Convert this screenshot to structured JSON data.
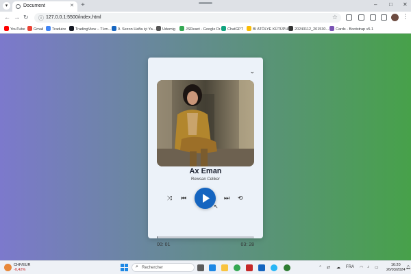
{
  "browser": {
    "tab_title": "Document",
    "tab_menu_icon": "chevron-down-icon",
    "tab_close": "✕",
    "new_tab": "+",
    "url": "127.0.0.1:5500/index.html",
    "window_controls": [
      "–",
      "□",
      "✕"
    ]
  },
  "bookmarks": [
    {
      "label": "YouTube",
      "color": "#ff0000"
    },
    {
      "label": "Gmail",
      "color": "#ea4335"
    },
    {
      "label": "Traduire",
      "color": "#4285f4"
    },
    {
      "label": "TradingView – Türn...",
      "color": "#131722"
    },
    {
      "label": "9. Sezon Hafta içi Ya...",
      "color": "#1565c0"
    },
    {
      "label": "Udemig",
      "color": "#555555"
    },
    {
      "label": "JSReact - Google Dr...",
      "color": "#34a853"
    },
    {
      "label": "ChatGPT",
      "color": "#10a37f"
    },
    {
      "label": "BI ATÖLYE KÜTÜPH...",
      "color": "#fbbc04"
    },
    {
      "label": "20240112_201530...",
      "color": "#333333"
    },
    {
      "label": "Cards - Bootstrap v5.1",
      "color": "#7952b3"
    }
  ],
  "player": {
    "menu_icon": "⌄",
    "song_title": "Ax Eman",
    "artist": "Rewsan Celiker",
    "controls": {
      "shuffle": "⤨",
      "prev": "⏮",
      "next": "⏭",
      "repeat": "⟲"
    },
    "current_time": "00: 01",
    "duration": "03: 28",
    "progress": 0.005,
    "accent_color": "#1565c0"
  },
  "taskbar": {
    "currency": "CHF/EUR",
    "currency_change": "-0,42%",
    "search_placeholder": "Rechercher",
    "language": "FRA",
    "time": "16:20",
    "date": "26/03/2024"
  }
}
